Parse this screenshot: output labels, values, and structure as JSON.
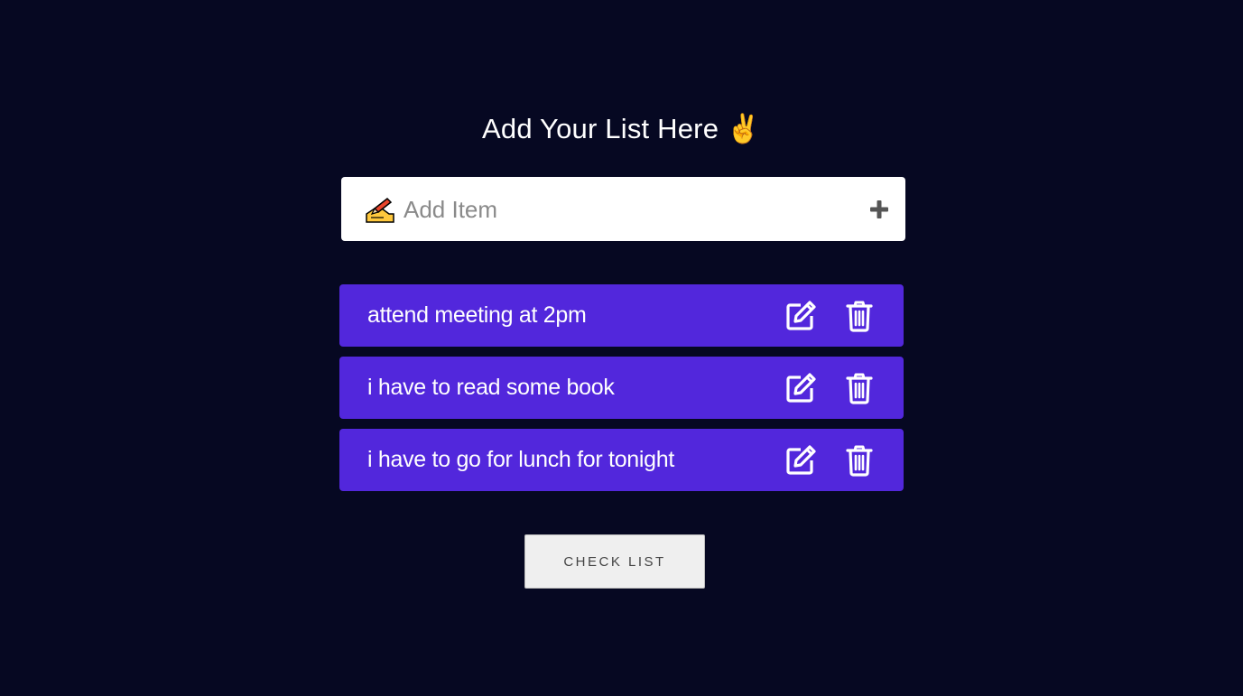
{
  "header": {
    "title": "Add Your List Here",
    "title_emoji": "✌️"
  },
  "add_item": {
    "placeholder": "Add Item",
    "value": "",
    "leading_icon": "writing-hand-icon",
    "add_icon": "plus-icon"
  },
  "todo_items": [
    {
      "text": "attend meeting at 2pm",
      "edit_icon": "edit-icon",
      "delete_icon": "trash-icon"
    },
    {
      "text": "i have to read some book",
      "edit_icon": "edit-icon",
      "delete_icon": "trash-icon"
    },
    {
      "text": "i have to go for lunch for tonight",
      "edit_icon": "edit-icon",
      "delete_icon": "trash-icon"
    }
  ],
  "actions": {
    "check_list_label": "CHECK LIST"
  },
  "colors": {
    "background": "#060822",
    "item_background": "#5227dc",
    "input_background": "#ffffff",
    "button_background": "#efefef"
  }
}
